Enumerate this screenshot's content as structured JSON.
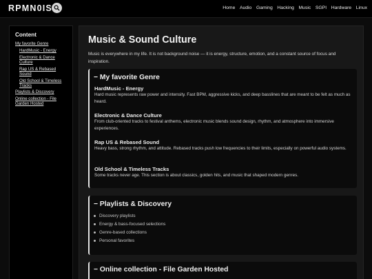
{
  "header": {
    "logo": "RPMN0ISE",
    "nav": [
      "Home",
      "Audio",
      "Gaming",
      "Hacking",
      "Music",
      "SGPI",
      "Hardware",
      "Linux"
    ]
  },
  "sidebar": {
    "title": "Content",
    "links": [
      {
        "label": "My favorite Genre"
      },
      {
        "label": "HardMusic - Energy"
      },
      {
        "label": "Electronic & Dance Culture"
      },
      {
        "label": "Rap US & Rebased Sound"
      },
      {
        "label": "Old School & Timeless Tracks"
      },
      {
        "label": "Playlists & Discovery"
      },
      {
        "label": "Online collection - File Garden Hosted"
      }
    ]
  },
  "main": {
    "title": "Music & Sound Culture",
    "intro": "Music is everywhere in my life. It is not background noise — it is energy, structure, emotion, and a constant source of focus and inspiration.",
    "genre_section": {
      "heading": "− My favorite Genre",
      "items": [
        {
          "title": "HardMusic - Energy",
          "text": "Hard music represents raw power and intensity. Fast BPM, aggressive kicks, and deep basslines that are meant to be felt as much as heard."
        },
        {
          "title": "Electronic & Dance Culture",
          "text": "From club-oriented tracks to festival anthems, electronic music blends sound design, rhythm, and atmosphere into immersive experiences."
        },
        {
          "title": "Rap US & Rebased Sound",
          "text": "Heavy bass, strong rhythm, and attitude. Rebased tracks push low frequencies to their limits, especially on powerful audio systems."
        },
        {
          "title": "Old School & Timeless Tracks",
          "text": "Some tracks never age. This section is about classics, golden hits, and music that shaped modern genres."
        }
      ]
    },
    "playlists_section": {
      "heading": "− Playlists & Discovery",
      "items": [
        "Discovery playlists",
        "Energy & bass-focused selections",
        "Genre-based collections",
        "Personal favorites"
      ]
    },
    "online_section": {
      "heading": "− Online collection - File Garden Hosted"
    }
  }
}
